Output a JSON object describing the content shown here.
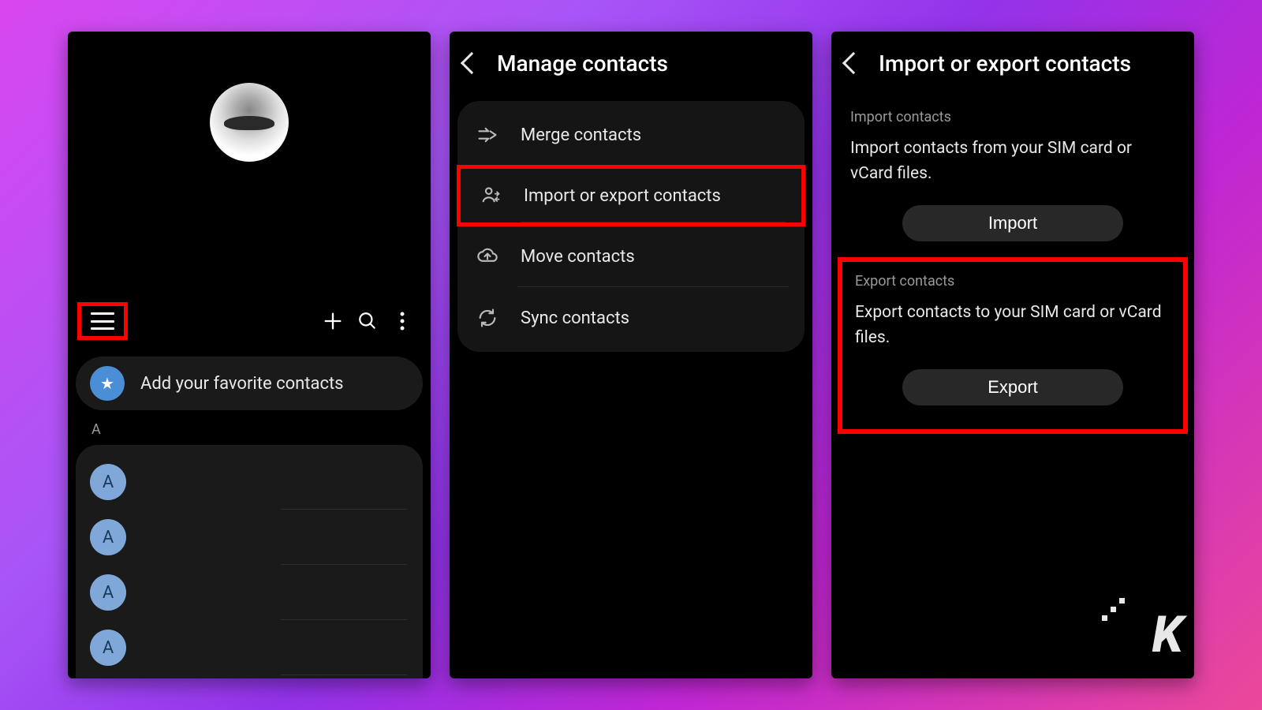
{
  "panel1": {
    "fav_label": "Add your favorite contacts",
    "section_letter": "A",
    "contact_letter": "A"
  },
  "panel2": {
    "title": "Manage contacts",
    "items": [
      {
        "label": "Merge contacts"
      },
      {
        "label": "Import or export contacts"
      },
      {
        "label": "Move contacts"
      },
      {
        "label": "Sync contacts"
      }
    ]
  },
  "panel3": {
    "title": "Import or export contacts",
    "import": {
      "section": "Import contacts",
      "desc": "Import contacts from your SIM card or vCard files.",
      "button": "Import"
    },
    "export": {
      "section": "Export contacts",
      "desc": "Export contacts to your SIM card or vCard files.",
      "button": "Export"
    }
  },
  "logo": "K"
}
